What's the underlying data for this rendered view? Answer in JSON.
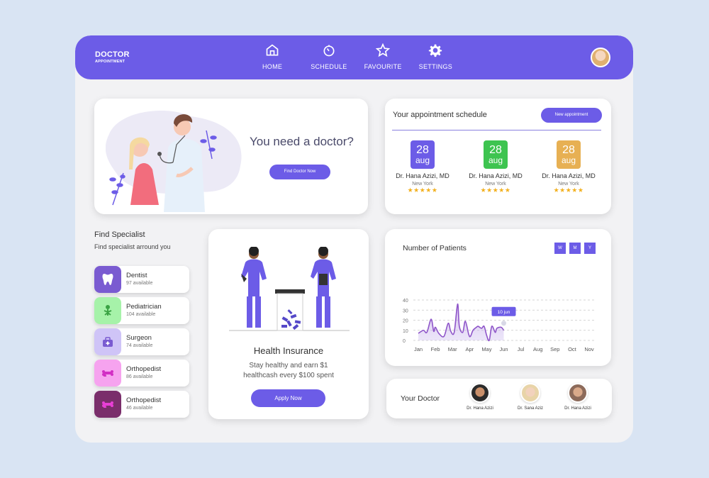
{
  "brand": {
    "title": "DOCTOR",
    "subtitle": "APPOINTMENT"
  },
  "nav": [
    {
      "label": "HOME",
      "icon": "home-icon"
    },
    {
      "label": "SCHEDULE",
      "icon": "timer-icon"
    },
    {
      "label": "FAVOURITE",
      "icon": "star-icon"
    },
    {
      "label": "SETTINGS",
      "icon": "gear-icon"
    }
  ],
  "hero": {
    "title": "You need a doctor?",
    "button": "Find Doctor Now"
  },
  "schedule": {
    "title": "Your appointment schedule",
    "new_button": "New appointment",
    "appointments": [
      {
        "day": "28",
        "month": "aug",
        "doctor": "Dr. Hana Azizi, MD",
        "location": "New York",
        "stars": "★★★★★",
        "color": "#6c5ce7"
      },
      {
        "day": "28",
        "month": "aug",
        "doctor": "Dr. Hana Azizi, MD",
        "location": "New York",
        "stars": "★★★★★",
        "color": "#3ec450"
      },
      {
        "day": "28",
        "month": "aug",
        "doctor": "Dr. Hana Azizi, MD",
        "location": "New York",
        "stars": "★★★★★",
        "color": "#e7b053"
      }
    ]
  },
  "specialist": {
    "title": "Find Specialist",
    "subtitle": "Find specialist arround you",
    "items": [
      {
        "name": "Dentist",
        "count": "97 available",
        "color": "#7a5bd1",
        "icon": "tooth-icon"
      },
      {
        "name": "Pediatrician",
        "count": "104 available",
        "color": "#a6f2a9",
        "icon": "child-icon"
      },
      {
        "name": "Surgeon",
        "count": "74 available",
        "color": "#cfc4f7",
        "icon": "medical-bag-icon"
      },
      {
        "name": "Orthopedist",
        "count": "86 available",
        "color": "#f6a3ef",
        "icon": "bone-icon"
      },
      {
        "name": "Orthopedist",
        "count": "46 available",
        "color": "#7a2e6b",
        "icon": "bone-icon"
      }
    ]
  },
  "insurance": {
    "title": "Health Insurance",
    "description_line1": "Stay healthy and earn $1",
    "description_line2": "healthcash every $100 spent",
    "button": "Apply Now"
  },
  "patients_chart": {
    "title": "Number of Patients",
    "ranges": [
      "W",
      "M",
      "Y"
    ],
    "tooltip": "10 jun"
  },
  "chart_data": {
    "type": "area",
    "title": "Number of Patients",
    "categories": [
      "Jan",
      "Feb",
      "Mar",
      "Apr",
      "May",
      "Jun",
      "Jul",
      "Aug",
      "Sep",
      "Oct",
      "Nov"
    ],
    "yticks": [
      0,
      10,
      20,
      30,
      40
    ],
    "ylim": [
      0,
      40
    ],
    "series": [
      {
        "x": [
          0,
          0.3,
          0.5,
          0.75,
          0.9,
          1.0,
          1.2,
          1.5,
          1.75,
          1.9,
          2.1,
          2.3,
          2.4,
          2.6,
          2.75,
          2.95,
          3.05,
          3.2,
          3.4,
          3.5,
          3.7,
          3.85,
          4.0,
          4.15,
          4.3,
          4.5,
          4.6,
          4.85,
          5.0
        ],
        "values": [
          7,
          10,
          8,
          21,
          9,
          13,
          7,
          4,
          17,
          9,
          8,
          36,
          14,
          8,
          19,
          6,
          4,
          10,
          13,
          14,
          12,
          14,
          5,
          0,
          14,
          8,
          12,
          13,
          10
        ]
      }
    ],
    "grid": true
  },
  "your_doctor": {
    "title": "Your Doctor",
    "doctors": [
      {
        "name": "Dr. Hana Azizi"
      },
      {
        "name": "Dr. Sana Aziz"
      },
      {
        "name": "Dr. Hana Azizi"
      }
    ]
  },
  "colors": {
    "accent": "#6c5ce7",
    "background": "#d9e4f3"
  }
}
